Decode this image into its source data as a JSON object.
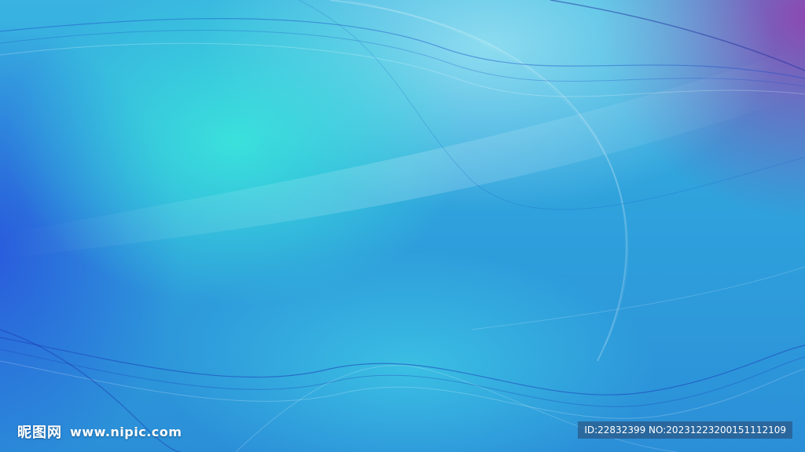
{
  "watermark": {
    "logo_text": "昵图网",
    "site": "www.nipic.com",
    "id_text": "ID:22832399 NO:20231223200151112109"
  },
  "colors": {
    "cyan": "#3cebdc",
    "blue": "#2b8fd8",
    "deep_blue": "#2850dc",
    "purple": "#963caa"
  }
}
